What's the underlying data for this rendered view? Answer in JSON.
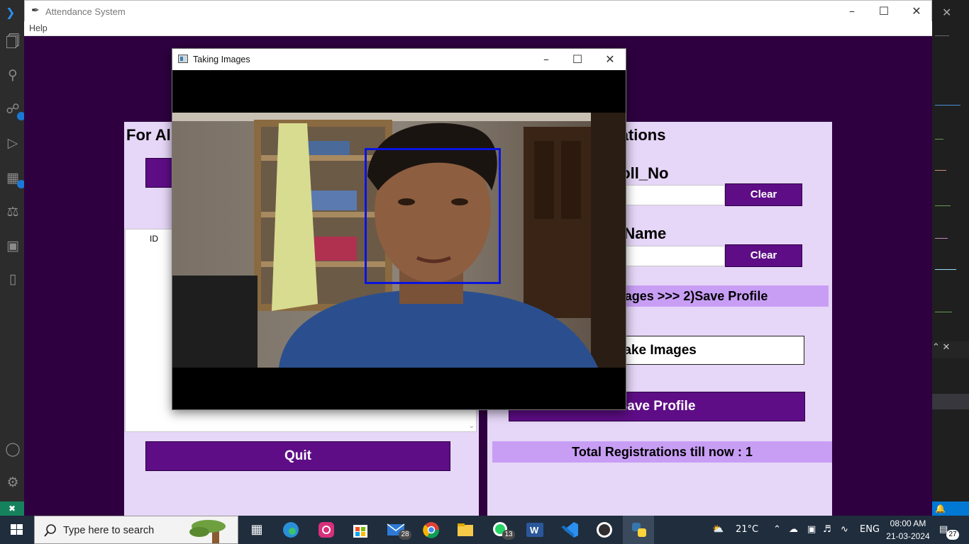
{
  "app": {
    "title": "Attendance System",
    "menu_help": "Help",
    "left_panel": {
      "heading": "For Already Registered",
      "tree_column_id": "ID",
      "quit_label": "Quit"
    },
    "right_panel": {
      "heading": "For New Registrations",
      "roll_label": "Enter Roll_No",
      "roll_value": "",
      "name_label": "Enter Name",
      "name_value": "",
      "clear_label_1": "Clear",
      "clear_label_2": "Clear",
      "steps_text": "1)Take Images  >>>  2)Save Profile",
      "take_images_label": "Take Images",
      "save_profile_label": "Save Profile",
      "total_registrations": "Total Registrations till now  : 1"
    }
  },
  "camera_window": {
    "title": "Taking Images"
  },
  "taskbar": {
    "search_placeholder": "Type here to search",
    "mail_badge": "28",
    "whatsapp_badge": "13",
    "weather": "21°C",
    "language": "ENG",
    "time": "08:00 AM",
    "date": "21-03-2024",
    "notifications": "27"
  },
  "colors": {
    "app_bg": "#2e0040",
    "panel_bg": "#e6d6f7",
    "button_purple": "#5e0d86",
    "bar_lavender": "#c89ef5",
    "face_box": "#0a14e0"
  }
}
